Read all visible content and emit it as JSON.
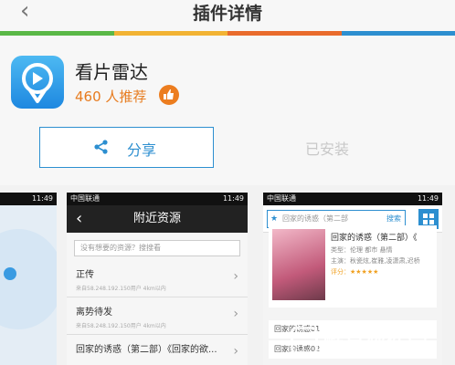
{
  "header": {
    "back_glyph": "‹",
    "title": "插件详情"
  },
  "rainbow_colors": [
    "#5ab847",
    "#f2b333",
    "#e96b2c",
    "#2d8fd0"
  ],
  "app": {
    "name": "看片雷达",
    "recommend": "460 人推荐",
    "icon": "radar-pin-icon"
  },
  "actions": {
    "share_label": "分享",
    "installed_label": "已安装"
  },
  "screenshots": [
    {
      "status_time": "11:49"
    },
    {
      "status_carrier": "中国联通",
      "status_time": "11:49",
      "title": "附近资源",
      "search_placeholder": "没有想要的资源？搜搜看",
      "rows": [
        {
          "title": "正传",
          "sub": "来自58.248.192.150用户    4km以内"
        },
        {
          "title": "离势待发",
          "sub": "来自58.248.192.150用户    4km以内"
        },
        {
          "title": "回家的诱惑（第二部）《回家的欲..."
        }
      ]
    },
    {
      "status_carrier": "中国联通",
      "status_time": "11:49",
      "search_text": "回家的诱惑（第二部",
      "search_button": "搜索",
      "detail_title": "回家的诱惑（第二部）《",
      "detail_type": "类型：伦理 都市 悬情",
      "detail_cast": "主演：秋瓷炫,崔雅,凌潇肃,迟桥",
      "detail_rating": "评分：★★★★★",
      "list": [
        "回家的诱惑01",
        "回家的诱惑02"
      ]
    }
  ],
  "watermark": "酷易软件园"
}
